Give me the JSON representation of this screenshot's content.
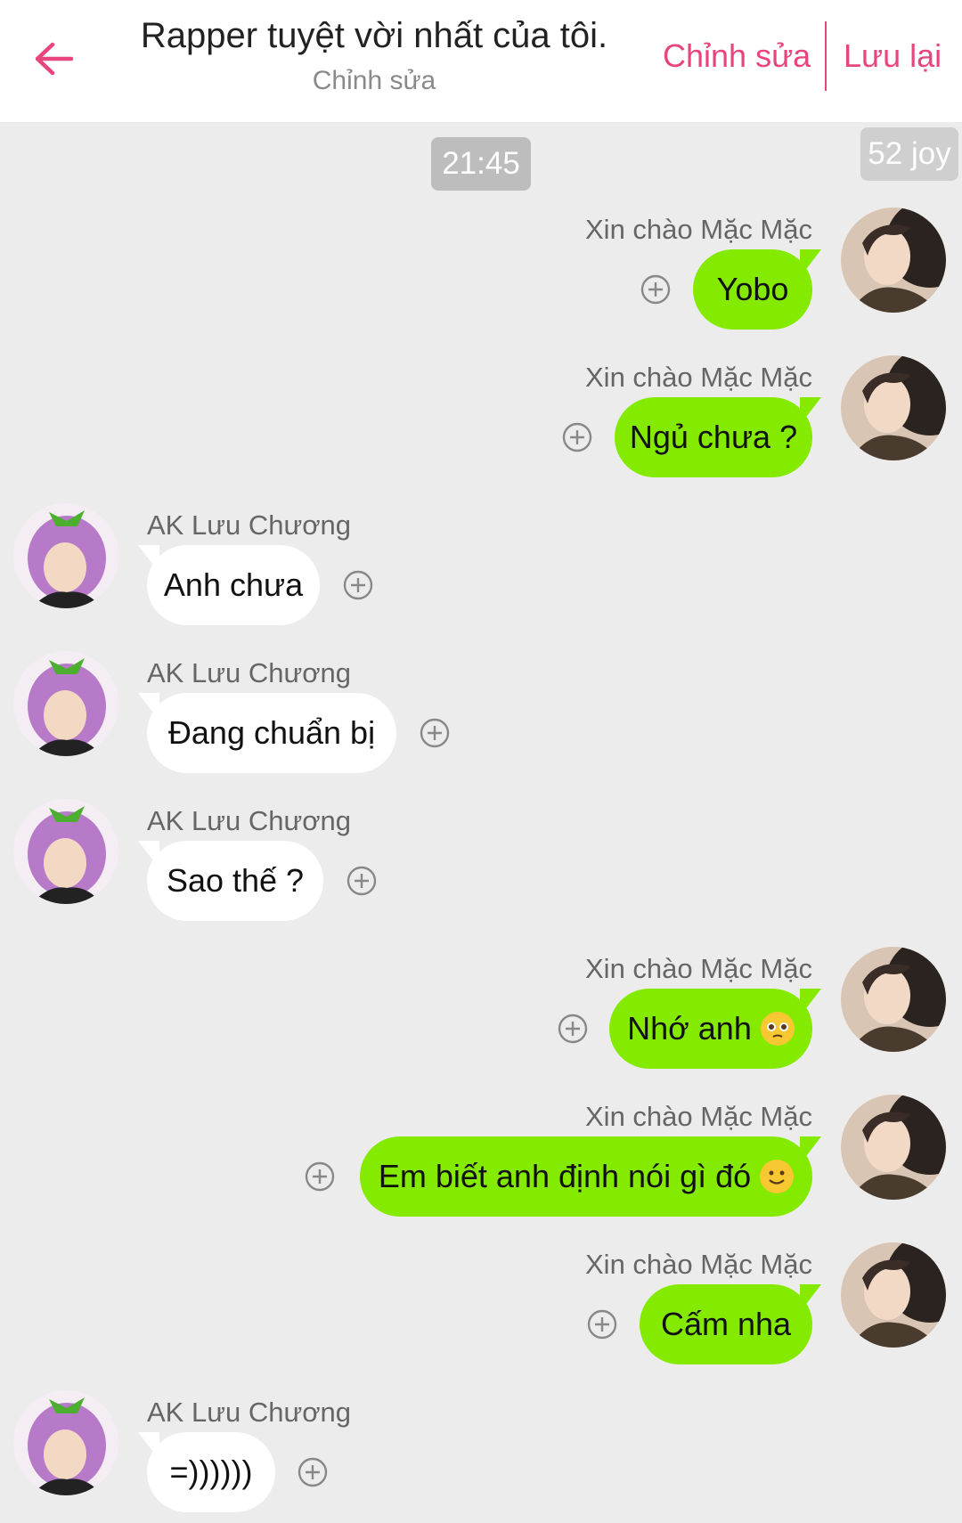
{
  "header": {
    "title": "Rapper tuyệt vời nhất của tôi.",
    "subtitle": "Chỉnh sửa",
    "edit_label": "Chỉnh sửa",
    "save_label": "Lưu lại",
    "accent": "#e8457f"
  },
  "time_label": "21:45",
  "joy_badge": "52 joy",
  "colors": {
    "sent_bubble": "#84ea00",
    "received_bubble": "#ffffff",
    "background": "#ececec"
  },
  "messages": [
    {
      "side": "right",
      "sender": "Xin chào Mặc Mặc",
      "text": "Yobo",
      "emoji": ""
    },
    {
      "side": "right",
      "sender": "Xin chào Mặc Mặc",
      "text": "Ngủ chưa ?",
      "emoji": ""
    },
    {
      "side": "left",
      "sender": "AK Lưu Chương",
      "text": "Anh chưa",
      "emoji": ""
    },
    {
      "side": "left",
      "sender": "AK Lưu Chương",
      "text": "Đang chuẩn bị",
      "emoji": ""
    },
    {
      "side": "left",
      "sender": "AK Lưu Chương",
      "text": "Sao thế ?",
      "emoji": ""
    },
    {
      "side": "right",
      "sender": "Xin chào Mặc Mặc",
      "text": "Nhớ anh",
      "emoji": "pleading-face-emoji"
    },
    {
      "side": "right",
      "sender": "Xin chào Mặc Mặc",
      "text": "Em biết anh định nói gì đó",
      "emoji": "slight-smile-emoji"
    },
    {
      "side": "right",
      "sender": "Xin chào Mặc Mặc",
      "text": "Cấm nha",
      "emoji": ""
    },
    {
      "side": "left",
      "sender": "AK Lưu Chương",
      "text": "=))))))",
      "emoji": ""
    }
  ]
}
